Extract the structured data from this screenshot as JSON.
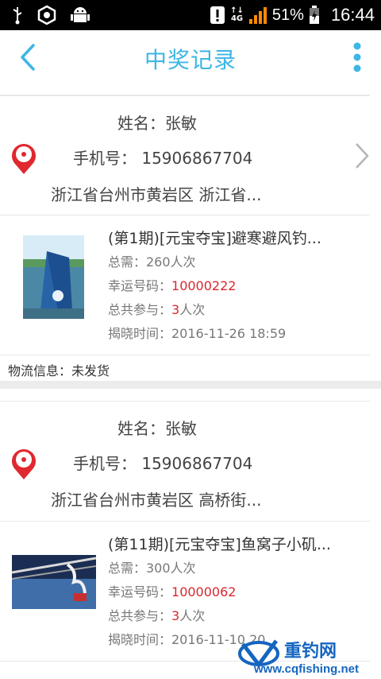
{
  "status_bar": {
    "battery_percent": "51%",
    "time": "16:44",
    "network": "4G",
    "icons": [
      "usb-icon",
      "hexagon-notification-icon",
      "android-icon",
      "alert-icon",
      "signal-icon",
      "battery-icon"
    ]
  },
  "header": {
    "title": "中奖记录"
  },
  "records": [
    {
      "name_label": "姓名：张敏",
      "phone_label": "手机号：",
      "phone": "15906867704",
      "address": "浙江省台州市黄岩区 浙江省...",
      "product": {
        "title": "(第1期)[元宝夺宝]避寒避风钓...",
        "need_label": "总需：260人次",
        "lucky_label": "幸运号码：",
        "lucky_number": "10000222",
        "participate_label": "总共参与：",
        "participate_count": "3",
        "participate_unit": "人次",
        "time_label": "揭晓时间：2016-11-26 18:59"
      },
      "logistics": "物流信息：未发货"
    },
    {
      "name_label": "姓名：张敏",
      "phone_label": "手机号：",
      "phone": "15906867704",
      "address": "浙江省台州市黄岩区 高桥街...",
      "product": {
        "title": "(第11期)[元宝夺宝]鱼窝子小矶...",
        "need_label": "总需：300人次",
        "lucky_label": "幸运号码：",
        "lucky_number": "10000062",
        "participate_label": "总共参与：",
        "participate_count": "3",
        "participate_unit": "人次",
        "time_label": "揭晓时间：2016-11-10 20"
      }
    }
  ],
  "watermark": {
    "brand": "重钓网",
    "url": "www.cqfishing.net"
  },
  "colors": {
    "accent": "#3db6e6",
    "red": "#d8282f"
  }
}
